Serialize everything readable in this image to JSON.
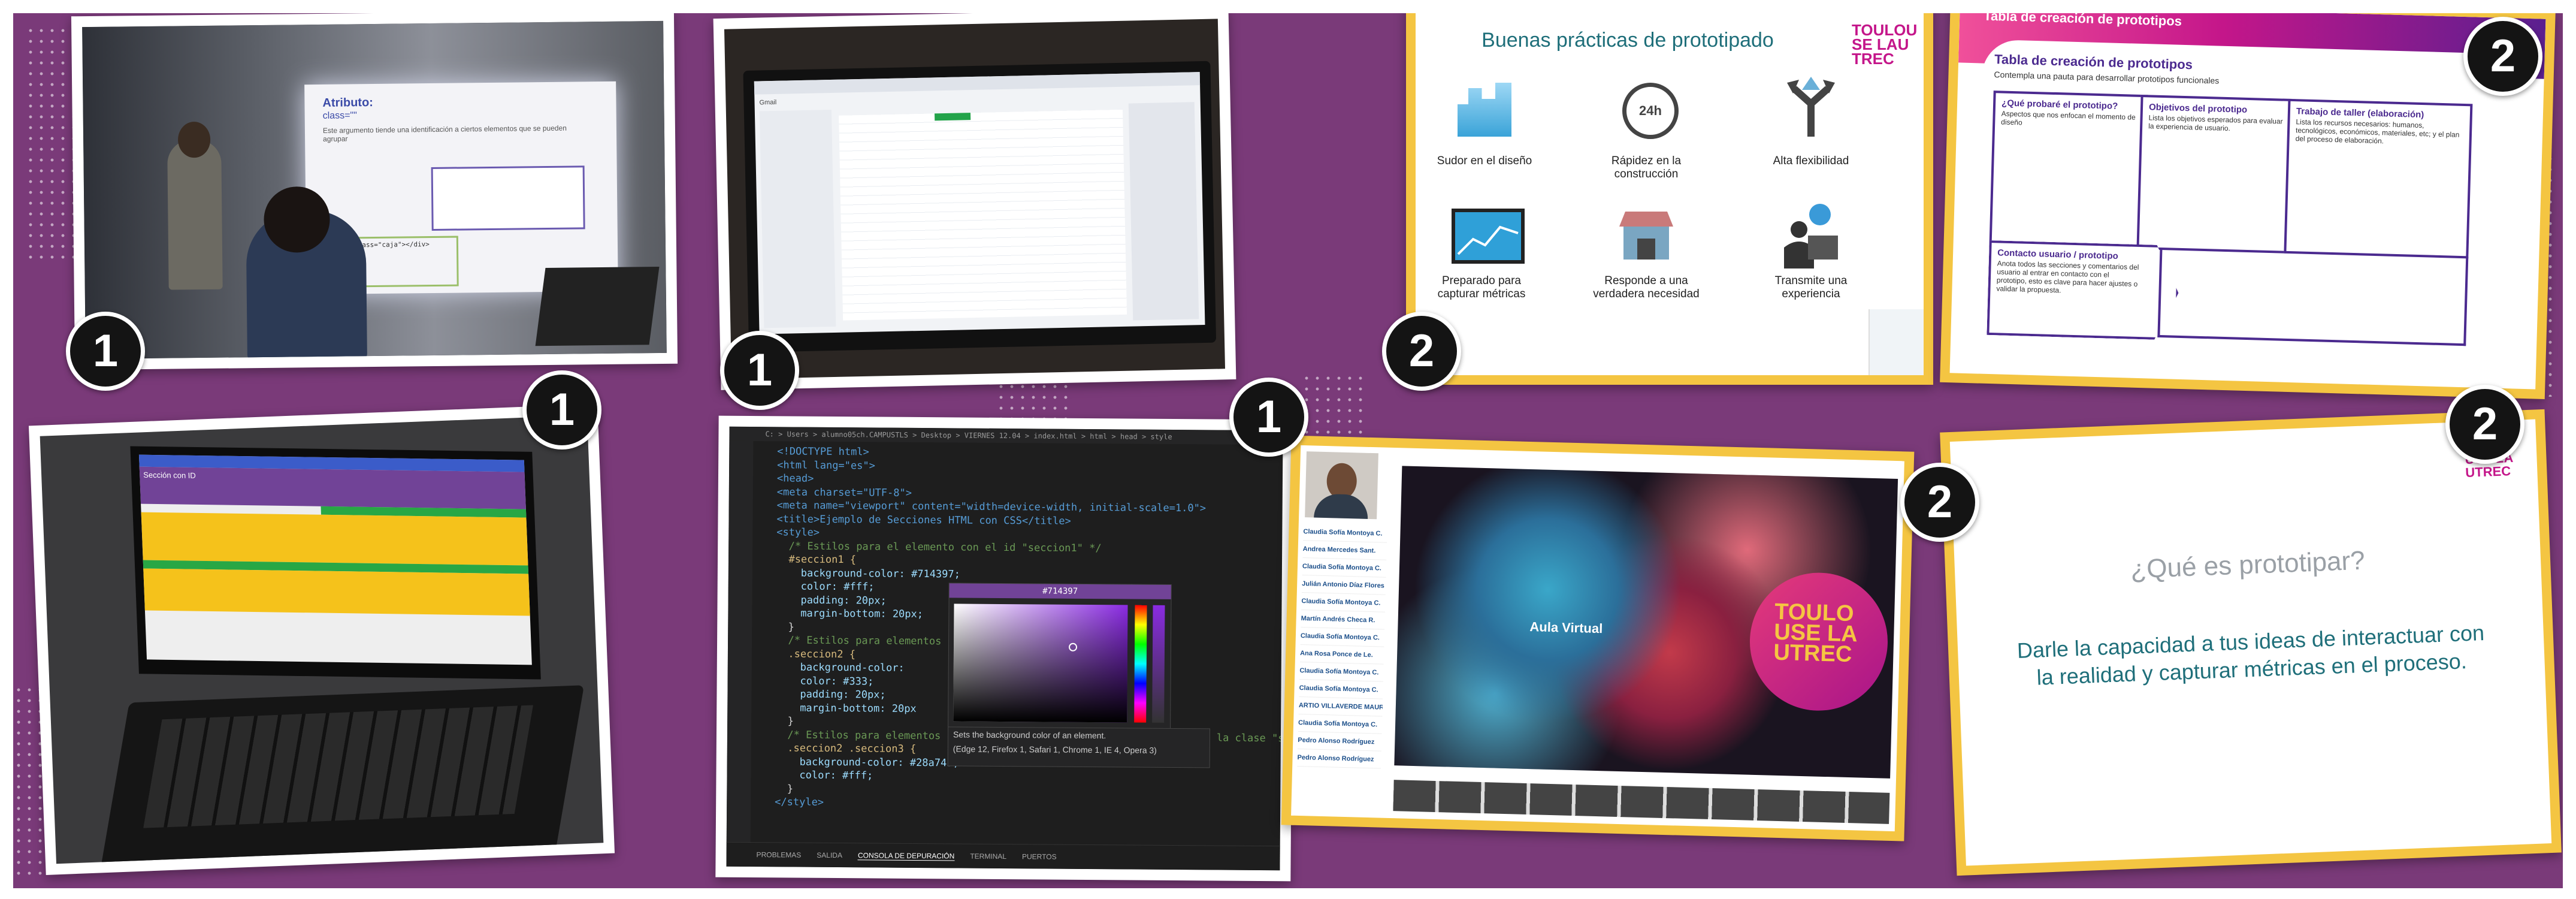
{
  "badges": {
    "one": "1",
    "two": "2"
  },
  "photo_classroom": {
    "slide_heading": "Atributo:",
    "slide_sub": "class=\"\"",
    "slide_text": "Este argumento tiende una identificación a ciertos elementos que se pueden agrupar",
    "code_line": "<div class=\"caja\"></div>"
  },
  "photo_laptop_browser": {
    "tab_label": "Gmail"
  },
  "photo_laptop_purple": {
    "page_title": "Sección con ID"
  },
  "code_editor": {
    "breadcrumb": "C: > Users > alumno05ch.CAMPUSTLS > Desktop > VIERNES 12.04 > index.html > html > head > style",
    "lines": [
      "<!DOCTYPE html>",
      "<html lang=\"es\">",
      "<head>",
      "<meta charset=\"UTF-8\">",
      "<meta name=\"viewport\" content=\"width=device-width, initial-scale=1.0\">",
      "<title>Ejemplo de Secciones HTML con CSS</title>",
      "<style>",
      "  /* Estilos para el elemento con el id \"seccion1\" */",
      "  #seccion1 {",
      "    background-color: #714397;",
      "    color: #fff;",
      "    padding: 20px;",
      "    margin-bottom: 20px;",
      "  }",
      "",
      "  /* Estilos para elementos",
      "  .seccion2 {",
      "    background-color:",
      "    color: #333;",
      "    padding: 20px;",
      "    margin-bottom: 20px",
      "  }",
      "",
      "  /* Estilos para elementos con la clase \"seccion3\" que están dentro de la clase \"seccion2\"",
      "  .seccion2 .seccion3 {",
      "    background-color: #28a745;",
      "    color: #fff;",
      "  }",
      "</style>"
    ],
    "picker_value": "#714397",
    "tooltip_line1": "Sets the background color of an element.",
    "tooltip_line2": "(Edge 12, Firefox 1, Safari 1, Chrome 1, IE 4, Opera 3)",
    "panel_tabs": [
      "PROBLEMAS",
      "SALIDA",
      "CONSOLA DE DEPURACIÓN",
      "TERMINAL",
      "PUERTOS"
    ]
  },
  "slide_practicas": {
    "title": "Buenas prácticas de prototipado",
    "brand": "TOULOUSE LAUTREC",
    "items": [
      {
        "label": "Sudor en el diseño",
        "icon": "buildings-icon"
      },
      {
        "label": "Rápidez en la construcción",
        "icon": "clock-24h-icon"
      },
      {
        "label": "Alta flexibilidad",
        "icon": "split-arrows-icon"
      },
      {
        "label": "Preparado para capturar métricas",
        "icon": "monitor-chart-icon"
      },
      {
        "label": "Responde a una verdadera necesidad",
        "icon": "store-icon"
      },
      {
        "label": "Transmite una experiencia",
        "icon": "person-screen-icon"
      }
    ]
  },
  "slide_tabla": {
    "banner": "Tabla de creación de prototipos",
    "title": "Tabla de creación de prototipos",
    "subtitle": "Contempla una pauta para desarrollar prototipos funcionales",
    "cells": [
      {
        "head": "¿Qué probaré el prototipo?",
        "body": "Aspectos que nos enfocan el momento de diseño"
      },
      {
        "head": "Objetivos del prototipo",
        "body": "Lista los objetivos esperados para evaluar la experiencia de usuario."
      },
      {
        "head": "Trabajo de taller (elaboración)",
        "body": "Lista los recursos necesarios: humanos, tecnológicos, económicos, materiales, etc; y el plan del proceso de elaboración."
      },
      {
        "head": "Contacto usuario / prototipo",
        "body": "Anota todos las secciones y comentarios del usuario al entrar en contacto con el prototipo, esto es clave para hacer ajustes o validar la propuesta."
      }
    ]
  },
  "aula_virtual": {
    "label": "Aula Virtual",
    "brand": "TOULOUSE LAUTREC",
    "participants": [
      "Claudia Sofía Montoya C.",
      "Andrea Mercedes Sant.",
      "Claudia Sofía Montoya C.",
      "Julián Antonio Díaz Flores",
      "Claudia Sofía Montoya C.",
      "Martín Andrés Checa R.",
      "Claudia Sofía Montoya C.",
      "Ana Rosa Ponce de Le.",
      "Claudia Sofía Montoya C.",
      "Claudia Sofía Montoya C.",
      "ARTIO VILLAVERDE MAURI",
      "Claudia Sofía Montoya C.",
      "Pedro Alonso Rodríguez",
      "Pedro Alonso Rodríguez"
    ]
  },
  "slide_prototipar": {
    "brand": "TOULOUSE LAUTREC",
    "question": "¿Qué es prototipar?",
    "answer": "Darle la capacidad a tus ideas de interactuar con la realidad y capturar métricas en el proceso."
  },
  "colors": {
    "background": "#7a3a79",
    "frame_yellow": "#f4c542",
    "brand_magenta": "#c4168a",
    "teal_text": "#1f6f7a",
    "table_purple": "#4b2a8f"
  }
}
